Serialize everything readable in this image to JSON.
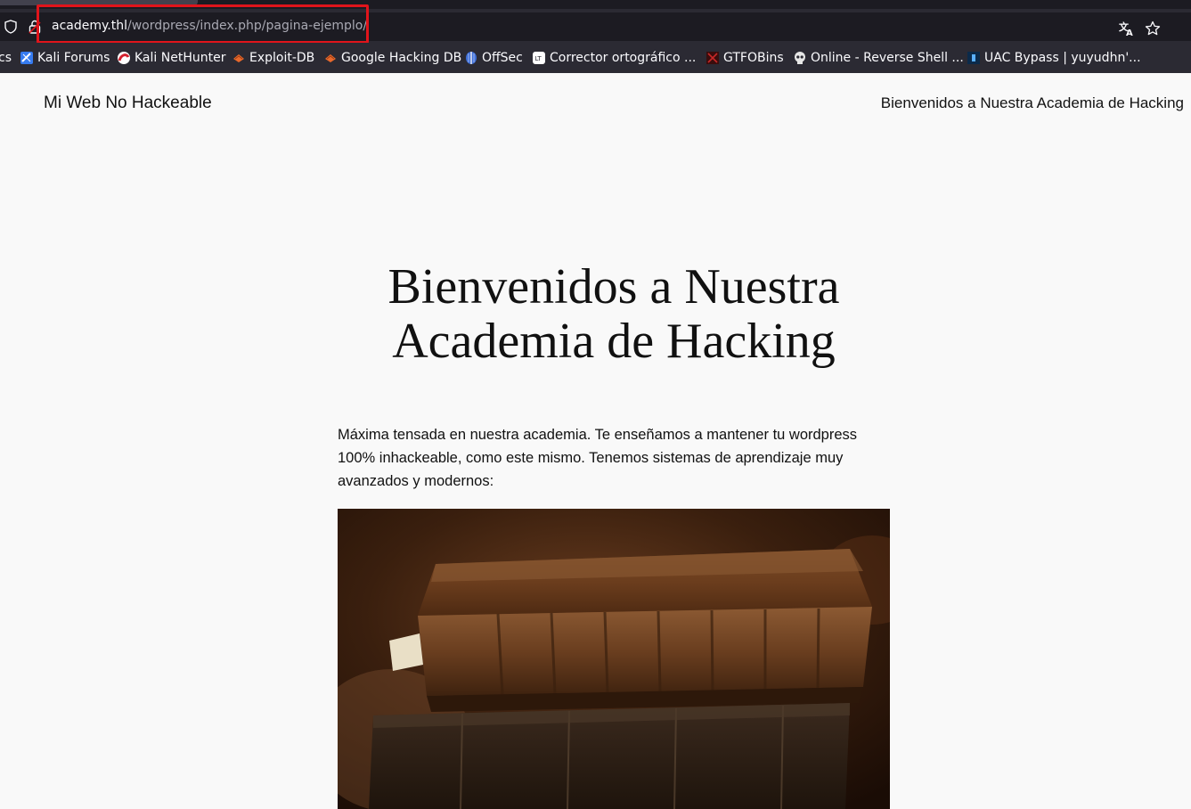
{
  "browser": {
    "url_host": "academy.thl",
    "url_path": "/wordpress/index.php/pagina-ejemplo/",
    "bookmarks": [
      {
        "label": "cs",
        "icon": "cut-off-icon"
      },
      {
        "label": "Kali Forums",
        "icon": "kali-forums-icon"
      },
      {
        "label": "Kali NetHunter",
        "icon": "kali-nethunter-icon"
      },
      {
        "label": "Exploit-DB",
        "icon": "exploit-db-icon"
      },
      {
        "label": "Google Hacking DB",
        "icon": "ghdb-icon"
      },
      {
        "label": "OffSec",
        "icon": "offsec-icon"
      },
      {
        "label": "Corrector ortográfico ...",
        "icon": "languagetool-icon"
      },
      {
        "label": "GTFOBins",
        "icon": "gtfobins-icon"
      },
      {
        "label": "Online - Reverse Shell ...",
        "icon": "skull-icon"
      },
      {
        "label": "UAC Bypass | yuyudhn'...",
        "icon": "uac-bypass-icon"
      }
    ]
  },
  "site": {
    "title": "Mi Web No Hackeable",
    "nav_link": "Bienvenidos a Nuestra Academia de Hacking"
  },
  "main": {
    "heading": "Bienvenidos a Nuestra Academia de Hacking",
    "intro": "Máxima tensada en nuestra academia. Te enseñamos a mantener tu wordpress 100% inhackeable, como este mismo. Tenemos sistemas de aprendizaje muy avanzados y modernos:"
  },
  "colors": {
    "highlight_box": "#e0141b",
    "chrome_dark": "#1c1b22",
    "chrome": "#2b2a33",
    "page_bg": "#f9f9f9"
  }
}
